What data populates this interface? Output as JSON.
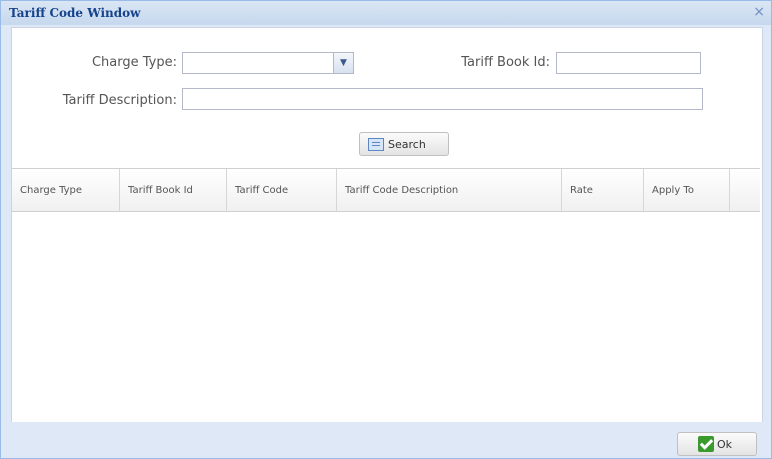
{
  "window": {
    "title": "Tariff Code Window",
    "close_glyph": "×"
  },
  "form": {
    "charge_type_label": "Charge Type:",
    "charge_type_value": "",
    "tariff_book_id_label": "Tariff Book Id:",
    "tariff_book_id_value": "",
    "tariff_description_label": "Tariff Description:",
    "tariff_description_value": "",
    "dropdown_glyph": "▼"
  },
  "search_button": {
    "label": "Search",
    "icon": "search-icon"
  },
  "grid": {
    "columns": [
      {
        "label": "Charge Type"
      },
      {
        "label": "Tariff Book Id"
      },
      {
        "label": "Tariff Code"
      },
      {
        "label": "Tariff Code Description"
      },
      {
        "label": "Rate"
      },
      {
        "label": "Apply To"
      }
    ],
    "rows": []
  },
  "ok_button": {
    "label": "Ok",
    "icon": "check-icon"
  }
}
